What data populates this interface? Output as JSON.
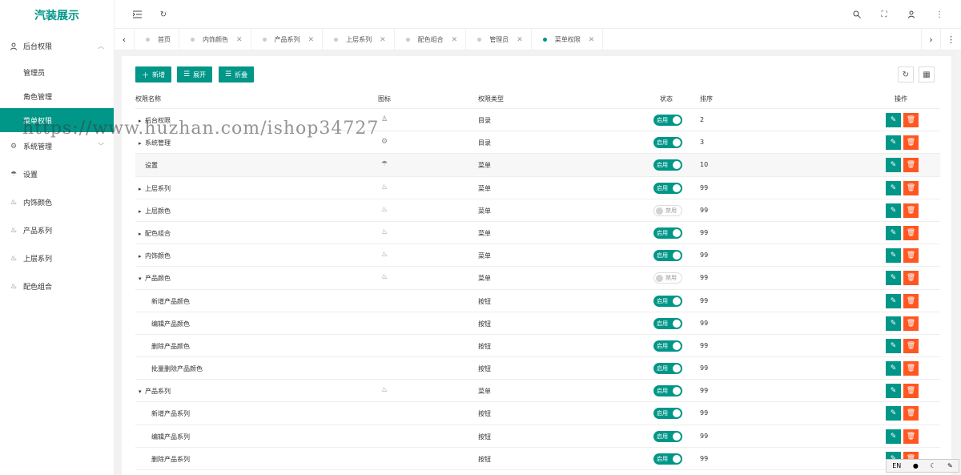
{
  "app": {
    "title": "汽装展示"
  },
  "sidebar": {
    "group": "后台权限",
    "sub_items": [
      "管理员",
      "角色管理",
      "菜单权限"
    ],
    "items": [
      "系统管理",
      "设置",
      "内饰颜色",
      "产品系列",
      "上层系列",
      "配色组合"
    ]
  },
  "tabs": [
    "首页",
    "内饰颜色",
    "产品系列",
    "上层系列",
    "配色组合",
    "管理员",
    "菜单权限"
  ],
  "toolbar": {
    "add": "新增",
    "expand": "展开",
    "collapse": "折叠"
  },
  "table": {
    "headers": {
      "name": "权限名称",
      "icon": "图标",
      "type": "权限类型",
      "status": "状态",
      "sort": "排序",
      "action": "操作"
    },
    "rows": [
      {
        "name": "后台权限",
        "type": "目录",
        "status": "启用",
        "sort": "2"
      },
      {
        "name": "系统管理",
        "type": "目录",
        "status": "启用",
        "sort": "3"
      },
      {
        "name": "设置",
        "type": "菜单",
        "status": "启用",
        "sort": "10"
      },
      {
        "name": "上层系列",
        "type": "菜单",
        "status": "启用",
        "sort": "99"
      },
      {
        "name": "上层颜色",
        "type": "菜单",
        "status": "禁用",
        "sort": "99"
      },
      {
        "name": "配色组合",
        "type": "菜单",
        "status": "启用",
        "sort": "99"
      },
      {
        "name": "内饰颜色",
        "type": "菜单",
        "status": "启用",
        "sort": "99"
      },
      {
        "name": "产品颜色",
        "type": "菜单",
        "status": "禁用",
        "sort": "99"
      },
      {
        "name": "新增产品颜色",
        "type": "按钮",
        "status": "启用",
        "sort": "99"
      },
      {
        "name": "编辑产品颜色",
        "type": "按钮",
        "status": "启用",
        "sort": "99"
      },
      {
        "name": "删除产品颜色",
        "type": "按钮",
        "status": "启用",
        "sort": "99"
      },
      {
        "name": "批量删除产品颜色",
        "type": "按钮",
        "status": "启用",
        "sort": "99"
      },
      {
        "name": "产品系列",
        "type": "菜单",
        "status": "启用",
        "sort": "99"
      },
      {
        "name": "新增产品系列",
        "type": "按钮",
        "status": "启用",
        "sort": "99"
      },
      {
        "name": "编辑产品系列",
        "type": "按钮",
        "status": "启用",
        "sort": "99"
      },
      {
        "name": "删除产品系列",
        "type": "按钮",
        "status": "启用",
        "sort": "99"
      }
    ]
  },
  "watermark": "https://www.huzhan.com/ishop34727",
  "ime": {
    "lang": "EN"
  },
  "colors": {
    "primary": "#009688",
    "danger": "#ff5722"
  }
}
